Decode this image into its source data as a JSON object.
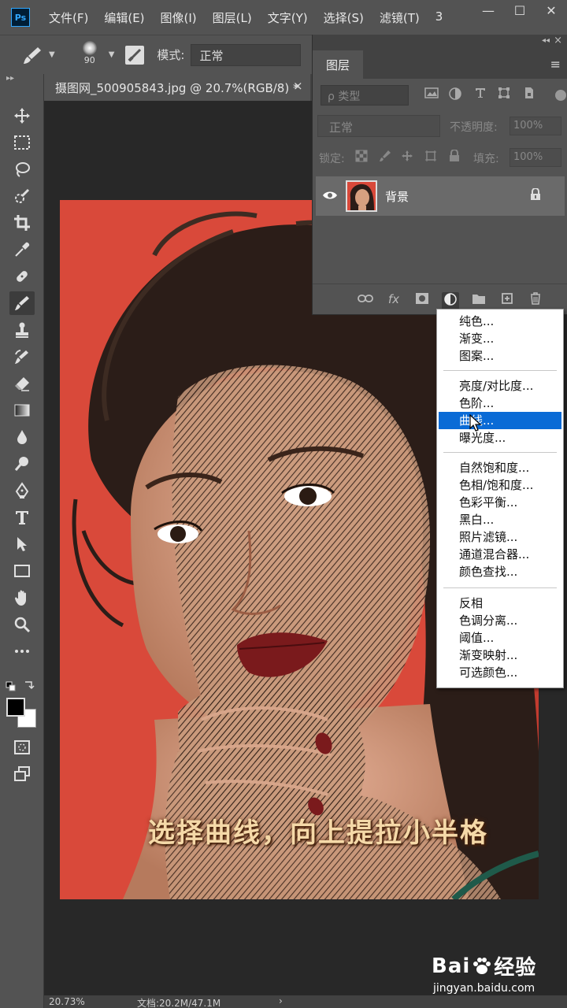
{
  "app": {
    "logo": "Ps"
  },
  "menubar": {
    "items": [
      "文件(F)",
      "编辑(E)",
      "图像(I)",
      "图层(L)",
      "文字(Y)",
      "选择(S)",
      "滤镜(T)",
      "3"
    ],
    "window_buttons": [
      "—",
      "☐",
      "✕"
    ]
  },
  "options": {
    "brush_size": "90",
    "mode_label": "模式:",
    "mode_value": "正常"
  },
  "document": {
    "tab_title": "摄图网_500905843.jpg @ 20.7%(RGB/8) *",
    "close": "×",
    "caption": "选择曲线，向上提拉小半格"
  },
  "status": {
    "zoom": "20.73%",
    "doc_info": "文档:20.2M/47.1M",
    "arrow": "›"
  },
  "watermark": {
    "brand_left": "Bai",
    "brand_right": "经验",
    "url": "jingyan.baidu.com"
  },
  "layers_panel": {
    "tab": "图层",
    "filter_placeholder": "ρ 类型",
    "blend_mode": "正常",
    "opacity_label": "不透明度:",
    "opacity_value": "100%",
    "lock_label": "锁定:",
    "fill_label": "填充:",
    "fill_value": "100%",
    "layer_name": "背景"
  },
  "adjust_menu": {
    "groups": [
      [
        "纯色...",
        "渐变...",
        "图案..."
      ],
      [
        "亮度/对比度...",
        "色阶...",
        "曲线...",
        "曝光度..."
      ],
      [
        "自然饱和度...",
        "色相/饱和度...",
        "色彩平衡...",
        "黑白...",
        "照片滤镜...",
        "通道混合器...",
        "颜色查找..."
      ],
      [
        "反相",
        "色调分离...",
        "阈值...",
        "渐变映射...",
        "可选颜色..."
      ]
    ],
    "selected": "曲线..."
  },
  "colors": {
    "accent_selected": "#0a6bd6",
    "ui_gray": "#535353",
    "canvas_bg": "#d9493a"
  }
}
